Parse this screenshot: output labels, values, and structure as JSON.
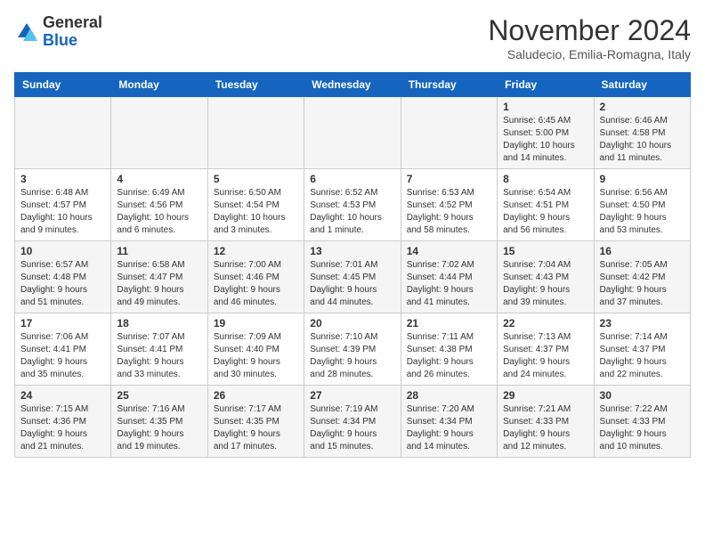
{
  "logo": {
    "general": "General",
    "blue": "Blue"
  },
  "title": "November 2024",
  "location": "Saludecio, Emilia-Romagna, Italy",
  "weekdays": [
    "Sunday",
    "Monday",
    "Tuesday",
    "Wednesday",
    "Thursday",
    "Friday",
    "Saturday"
  ],
  "weeks": [
    [
      {
        "day": "",
        "info": ""
      },
      {
        "day": "",
        "info": ""
      },
      {
        "day": "",
        "info": ""
      },
      {
        "day": "",
        "info": ""
      },
      {
        "day": "",
        "info": ""
      },
      {
        "day": "1",
        "info": "Sunrise: 6:45 AM\nSunset: 5:00 PM\nDaylight: 10 hours\nand 14 minutes."
      },
      {
        "day": "2",
        "info": "Sunrise: 6:46 AM\nSunset: 4:58 PM\nDaylight: 10 hours\nand 11 minutes."
      }
    ],
    [
      {
        "day": "3",
        "info": "Sunrise: 6:48 AM\nSunset: 4:57 PM\nDaylight: 10 hours\nand 9 minutes."
      },
      {
        "day": "4",
        "info": "Sunrise: 6:49 AM\nSunset: 4:56 PM\nDaylight: 10 hours\nand 6 minutes."
      },
      {
        "day": "5",
        "info": "Sunrise: 6:50 AM\nSunset: 4:54 PM\nDaylight: 10 hours\nand 3 minutes."
      },
      {
        "day": "6",
        "info": "Sunrise: 6:52 AM\nSunset: 4:53 PM\nDaylight: 10 hours\nand 1 minute."
      },
      {
        "day": "7",
        "info": "Sunrise: 6:53 AM\nSunset: 4:52 PM\nDaylight: 9 hours\nand 58 minutes."
      },
      {
        "day": "8",
        "info": "Sunrise: 6:54 AM\nSunset: 4:51 PM\nDaylight: 9 hours\nand 56 minutes."
      },
      {
        "day": "9",
        "info": "Sunrise: 6:56 AM\nSunset: 4:50 PM\nDaylight: 9 hours\nand 53 minutes."
      }
    ],
    [
      {
        "day": "10",
        "info": "Sunrise: 6:57 AM\nSunset: 4:48 PM\nDaylight: 9 hours\nand 51 minutes."
      },
      {
        "day": "11",
        "info": "Sunrise: 6:58 AM\nSunset: 4:47 PM\nDaylight: 9 hours\nand 49 minutes."
      },
      {
        "day": "12",
        "info": "Sunrise: 7:00 AM\nSunset: 4:46 PM\nDaylight: 9 hours\nand 46 minutes."
      },
      {
        "day": "13",
        "info": "Sunrise: 7:01 AM\nSunset: 4:45 PM\nDaylight: 9 hours\nand 44 minutes."
      },
      {
        "day": "14",
        "info": "Sunrise: 7:02 AM\nSunset: 4:44 PM\nDaylight: 9 hours\nand 41 minutes."
      },
      {
        "day": "15",
        "info": "Sunrise: 7:04 AM\nSunset: 4:43 PM\nDaylight: 9 hours\nand 39 minutes."
      },
      {
        "day": "16",
        "info": "Sunrise: 7:05 AM\nSunset: 4:42 PM\nDaylight: 9 hours\nand 37 minutes."
      }
    ],
    [
      {
        "day": "17",
        "info": "Sunrise: 7:06 AM\nSunset: 4:41 PM\nDaylight: 9 hours\nand 35 minutes."
      },
      {
        "day": "18",
        "info": "Sunrise: 7:07 AM\nSunset: 4:41 PM\nDaylight: 9 hours\nand 33 minutes."
      },
      {
        "day": "19",
        "info": "Sunrise: 7:09 AM\nSunset: 4:40 PM\nDaylight: 9 hours\nand 30 minutes."
      },
      {
        "day": "20",
        "info": "Sunrise: 7:10 AM\nSunset: 4:39 PM\nDaylight: 9 hours\nand 28 minutes."
      },
      {
        "day": "21",
        "info": "Sunrise: 7:11 AM\nSunset: 4:38 PM\nDaylight: 9 hours\nand 26 minutes."
      },
      {
        "day": "22",
        "info": "Sunrise: 7:13 AM\nSunset: 4:37 PM\nDaylight: 9 hours\nand 24 minutes."
      },
      {
        "day": "23",
        "info": "Sunrise: 7:14 AM\nSunset: 4:37 PM\nDaylight: 9 hours\nand 22 minutes."
      }
    ],
    [
      {
        "day": "24",
        "info": "Sunrise: 7:15 AM\nSunset: 4:36 PM\nDaylight: 9 hours\nand 21 minutes."
      },
      {
        "day": "25",
        "info": "Sunrise: 7:16 AM\nSunset: 4:35 PM\nDaylight: 9 hours\nand 19 minutes."
      },
      {
        "day": "26",
        "info": "Sunrise: 7:17 AM\nSunset: 4:35 PM\nDaylight: 9 hours\nand 17 minutes."
      },
      {
        "day": "27",
        "info": "Sunrise: 7:19 AM\nSunset: 4:34 PM\nDaylight: 9 hours\nand 15 minutes."
      },
      {
        "day": "28",
        "info": "Sunrise: 7:20 AM\nSunset: 4:34 PM\nDaylight: 9 hours\nand 14 minutes."
      },
      {
        "day": "29",
        "info": "Sunrise: 7:21 AM\nSunset: 4:33 PM\nDaylight: 9 hours\nand 12 minutes."
      },
      {
        "day": "30",
        "info": "Sunrise: 7:22 AM\nSunset: 4:33 PM\nDaylight: 9 hours\nand 10 minutes."
      }
    ]
  ]
}
